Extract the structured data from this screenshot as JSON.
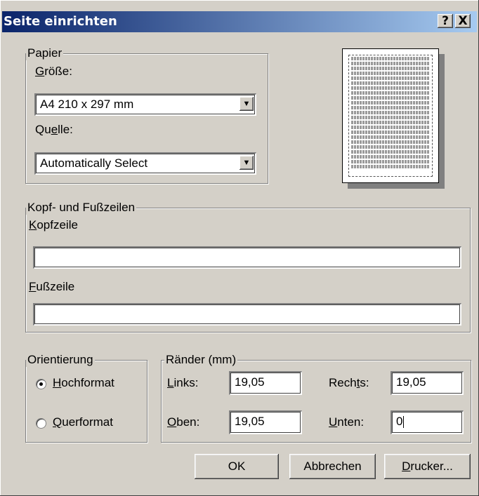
{
  "window": {
    "title": "Seite einrichten",
    "help_label": "?",
    "close_label": "X"
  },
  "paper": {
    "legend": "Papier",
    "size_label": "Größe:",
    "size_value": "A4 210 x 297 mm",
    "source_label": "Quelle:",
    "source_value": "Automatically Select"
  },
  "header_footer": {
    "legend": "Kopf- und Fußzeilen",
    "header_label": "Kopfzeile",
    "header_value": "",
    "footer_label": "Fußzeile",
    "footer_value": ""
  },
  "orientation": {
    "legend": "Orientierung",
    "portrait_label": "Hochformat",
    "landscape_label": "Querformat",
    "selected": "portrait"
  },
  "margins": {
    "legend": "Ränder (mm)",
    "left_label": "Links:",
    "left_value": "19,05",
    "right_label": "Rechts:",
    "right_value": "19,05",
    "top_label": "Oben:",
    "top_value": "19,05",
    "bottom_label": "Unten:",
    "bottom_value": "0"
  },
  "buttons": {
    "ok": "OK",
    "cancel": "Abbrechen",
    "printer": "Drucker..."
  },
  "icons": {
    "dropdown": "chevron-down-icon"
  }
}
